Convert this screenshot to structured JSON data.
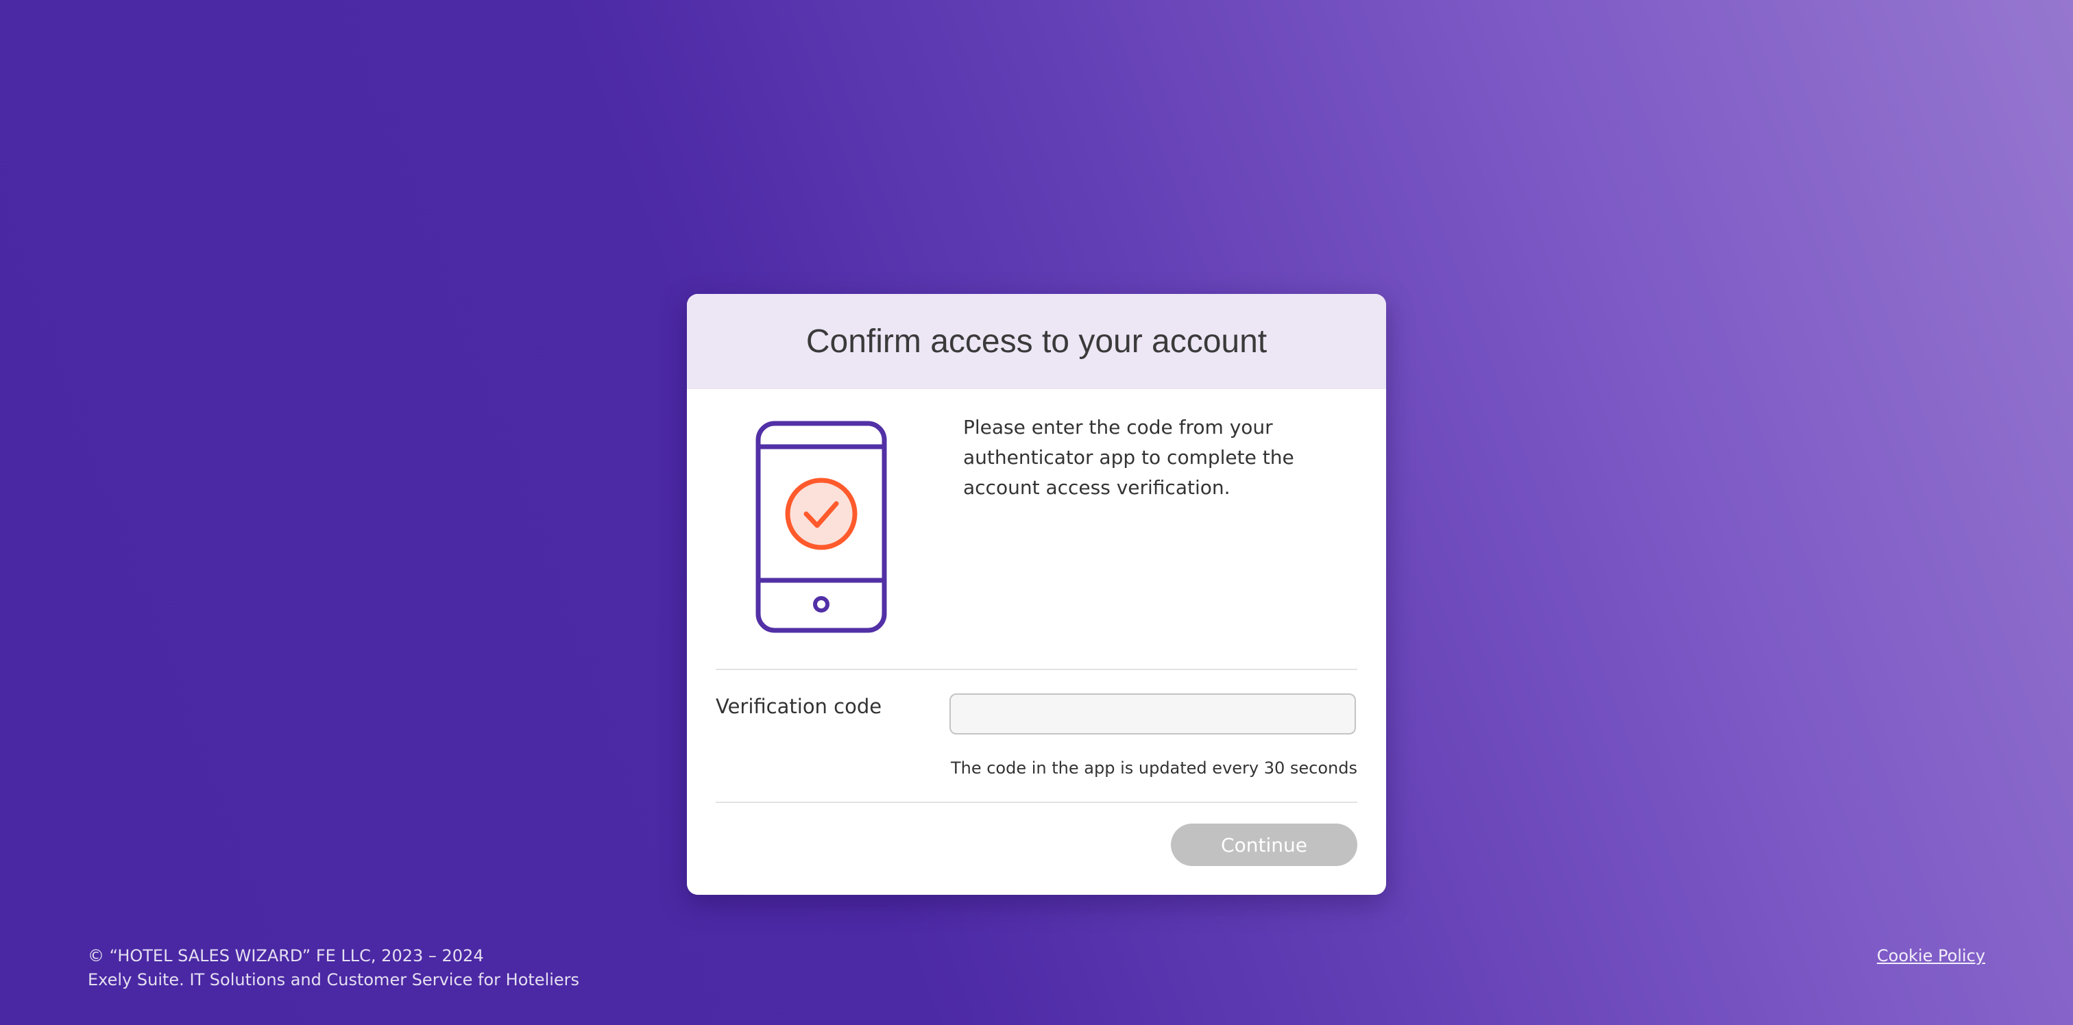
{
  "modal": {
    "title": "Confirm access to your account",
    "instructions": "Please enter the code from your authenticator app to complete the account access verification.",
    "illustration_icon": "phone-check-icon",
    "field_label": "Verification code",
    "field_value": "",
    "field_placeholder": "",
    "hint": "The code in the app is updated every 30 seconds",
    "continue_label": "Continue"
  },
  "footer": {
    "copyright": "© “HOTEL SALES WIZARD” FE LLC, 2023 – 2024",
    "tagline": "Exely Suite. IT Solutions and Customer Service for Hoteliers",
    "cookie_label": "Cookie Policy"
  },
  "colors": {
    "background_start": "#4a28a3",
    "background_end": "#9677cf",
    "header_bg": "#ede6f5",
    "icon_purple": "#5230a6",
    "icon_orange": "#ff5a2c",
    "button_disabled": "#c1c1c1"
  }
}
